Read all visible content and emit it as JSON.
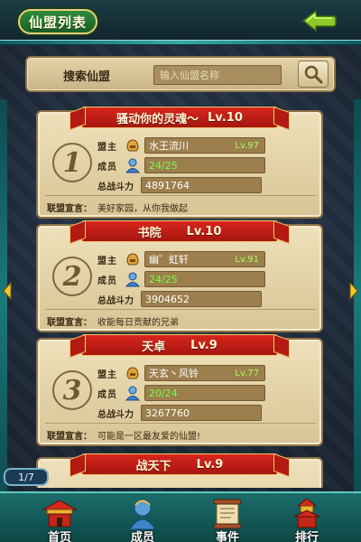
{
  "header": {
    "title": "仙盟列表",
    "back_icon": "back-arrow-icon"
  },
  "search": {
    "label": "搜索仙盟",
    "placeholder": "输入仙盟名称",
    "button_icon": "magnifier-icon"
  },
  "labels": {
    "leader": "盟主",
    "members": "成员",
    "power": "总战斗力",
    "declaration": "联盟宣言："
  },
  "alliances": [
    {
      "rank": "1",
      "name": "骚动你的灵魂～",
      "level": "Lv.10",
      "leader": "水王流川",
      "leader_level": "Lv.97",
      "members": "24/25",
      "power": "4891764",
      "declaration": "美好家园，从你我做起"
    },
    {
      "rank": "2",
      "name": "书院",
      "level": "Lv.10",
      "leader": "幽゛虹轩",
      "leader_level": "Lv.91",
      "members": "24/25",
      "power": "3904652",
      "declaration": "收能每日贡献的兄弟"
    },
    {
      "rank": "3",
      "name": "天卓",
      "level": "Lv.9",
      "leader": "天玄丶风铃",
      "leader_level": "Lv.77",
      "members": "20/24",
      "power": "3267760",
      "declaration": "可能是一区最友爱的仙盟!"
    },
    {
      "name": "战天下",
      "level": "Lv.9"
    }
  ],
  "pagination": {
    "text": "1/7"
  },
  "nav": [
    {
      "label": "首页",
      "icon": "palace-icon"
    },
    {
      "label": "成员",
      "icon": "member-icon"
    },
    {
      "label": "事件",
      "icon": "scroll-icon"
    },
    {
      "label": "排行",
      "icon": "tower-icon"
    }
  ],
  "colors": {
    "banner_red": "#c21c15",
    "parchment": "#e6d5aa",
    "teal": "#1b6d6a",
    "level_green": "#a4ff5a"
  }
}
